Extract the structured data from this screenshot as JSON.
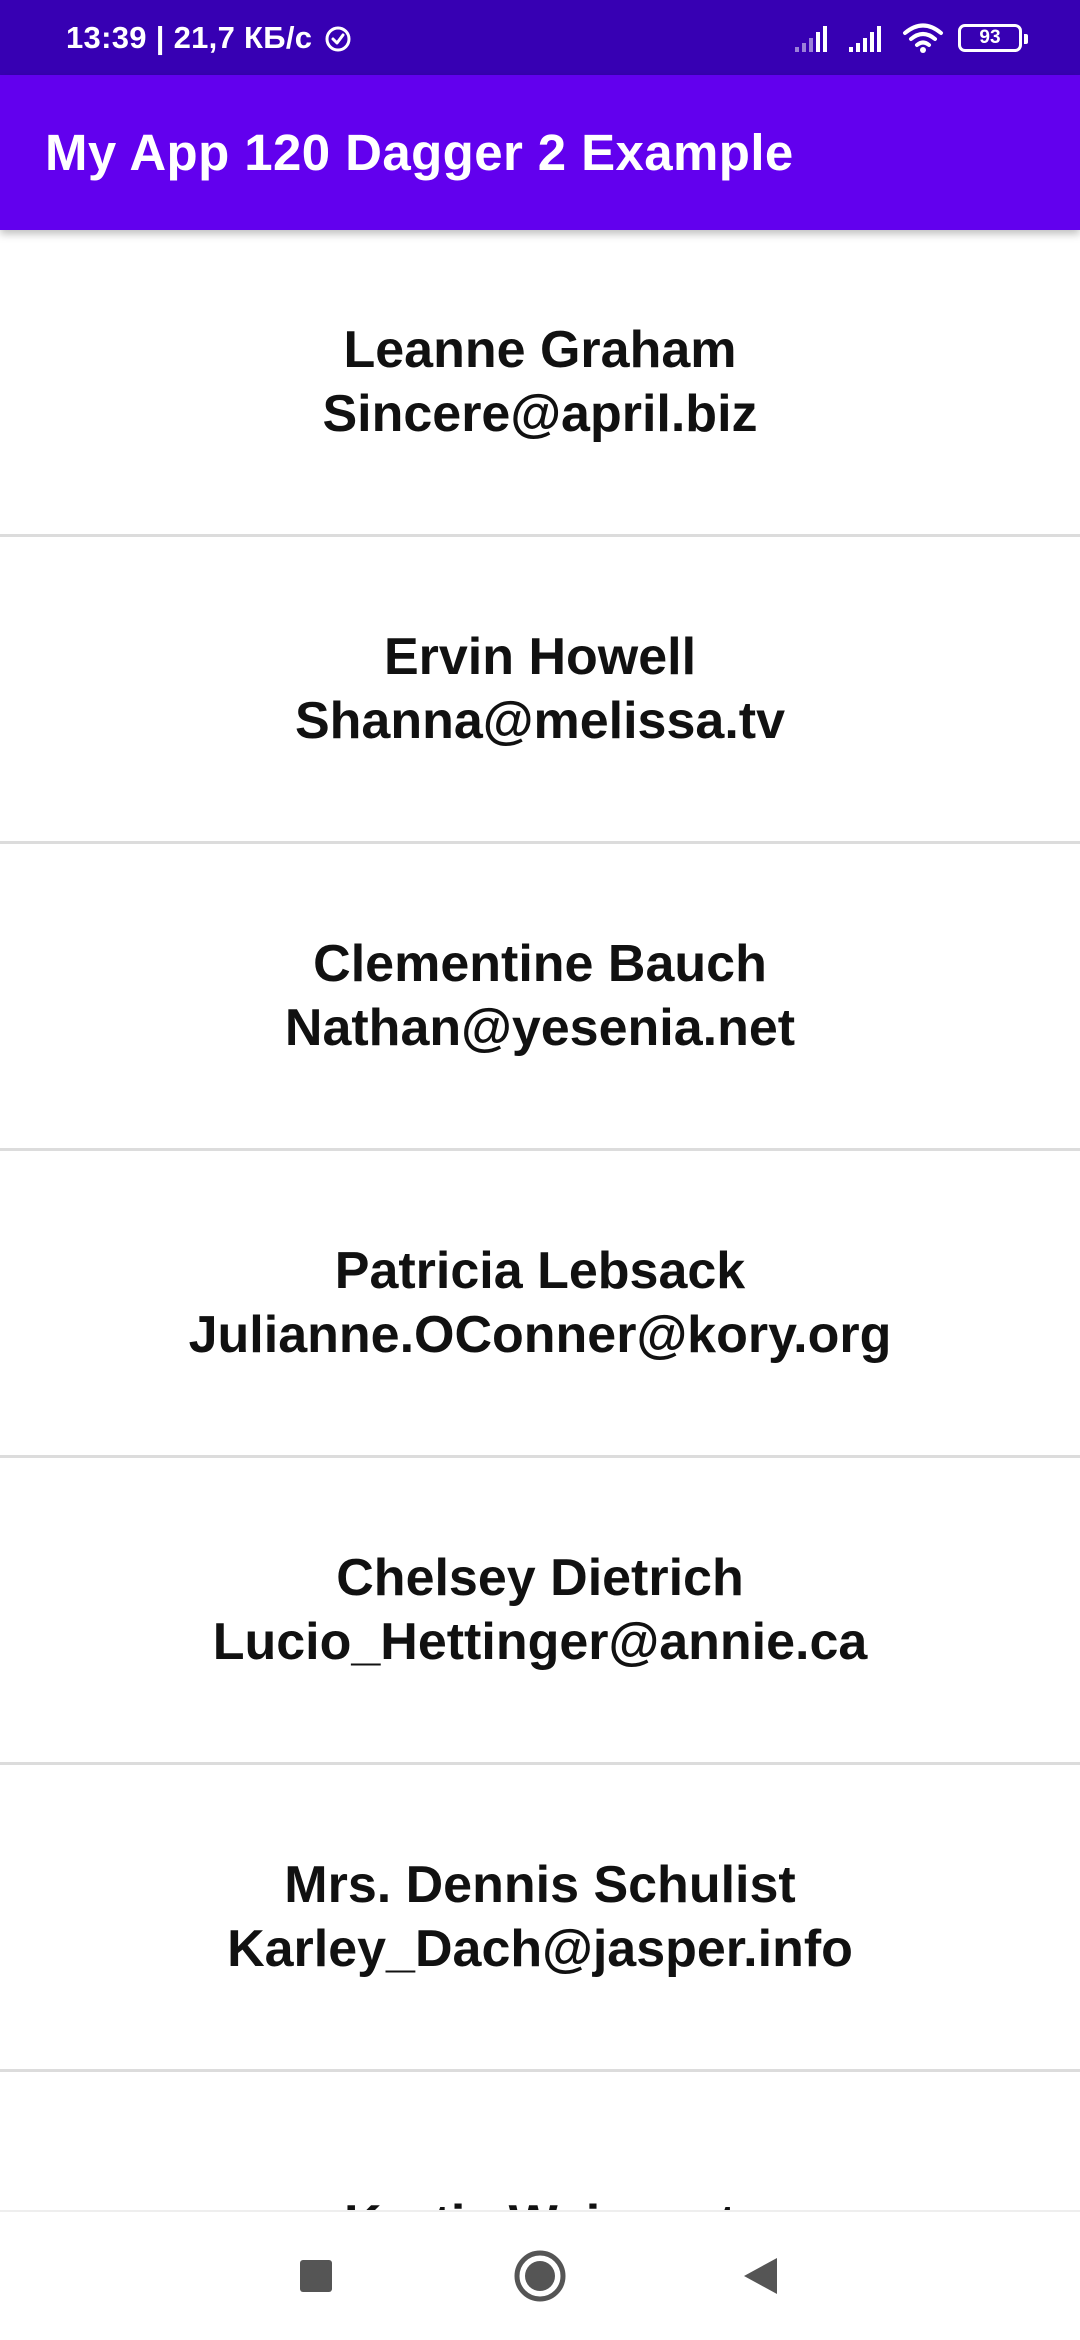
{
  "status_bar": {
    "time_speed": "13:39 | 21,7 КБ/с",
    "battery": "93",
    "icons": [
      "alarm-icon",
      "cellular-signal-icon",
      "cellular-signal-icon",
      "wifi-icon",
      "battery-icon"
    ]
  },
  "app_bar": {
    "title": "My App 120 Dagger 2 Example"
  },
  "users": [
    {
      "name": "Leanne Graham",
      "email": "Sincere@april.biz"
    },
    {
      "name": "Ervin Howell",
      "email": "Shanna@melissa.tv"
    },
    {
      "name": "Clementine Bauch",
      "email": "Nathan@yesenia.net"
    },
    {
      "name": "Patricia Lebsack",
      "email": "Julianne.OConner@kory.org"
    },
    {
      "name": "Chelsey Dietrich",
      "email": "Lucio_Hettinger@annie.ca"
    },
    {
      "name": "Mrs. Dennis Schulist",
      "email": "Karley_Dach@jasper.info"
    },
    {
      "name": "Kurtis Weissnat",
      "email": ""
    }
  ],
  "nav_bar": {
    "buttons": [
      "recents-icon",
      "home-icon",
      "back-icon"
    ]
  },
  "colors": {
    "status_bar": "#3700b3",
    "app_bar": "#6200ee",
    "text": "#111111",
    "divider": "#dcdcdc"
  }
}
